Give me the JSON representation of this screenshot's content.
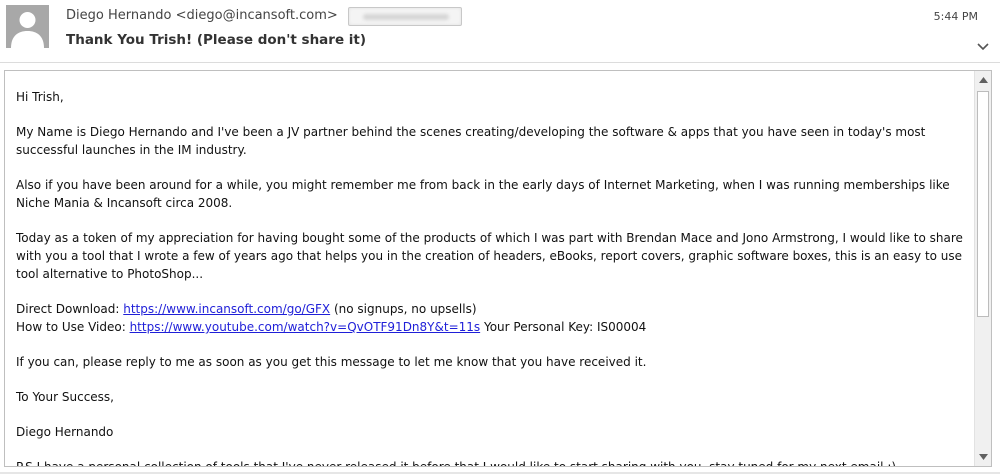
{
  "header": {
    "sender": "Diego Hernando <diego@incansoft.com>",
    "subject": "Thank You Trish! (Please don't share it)",
    "time": "5:44 PM",
    "avatar_icon": "person-silhouette-icon",
    "expand_icon": "chevron-down-icon"
  },
  "email": {
    "greeting": "Hi Trish,",
    "para1": "My Name is Diego Hernando and I've been a JV partner behind the scenes creating/developing the software & apps that you have seen in today's most successful launches in the IM industry.",
    "para2": "Also if you have been around for a while, you might remember me from back in the early days of Internet Marketing, when I was running memberships like Niche Mania & Incansoft circa 2008.",
    "para3": "Today as a token of my appreciation for having bought some of the products of which I was part with Brendan Mace and Jono Armstrong, I would like to share with you a tool that I wrote a few of years ago that helps you in the creation of headers, eBooks, report covers, graphic software boxes, this is an easy to use tool alternative to PhotoShop...",
    "download_label": "Direct Download: ",
    "download_link": "https://www.incansoft.com/go/GFX",
    "download_note": " (no signups, no upsells)",
    "video_label": "How to Use Video: ",
    "video_link": "https://www.youtube.com/watch?v=QvOTF91Dn8Y&t=11s",
    "key_text": " Your Personal Key: IS00004",
    "para4": "If you can, please reply to me as soon as you get this message to let me know that you have received it.",
    "closing": "To Your Success,",
    "signature": "Diego Hernando",
    "ps": "P.S I have a personal collection of tools that I've never released it before that I would like to start sharing with you, stay tuned for my next email :)"
  },
  "colors": {
    "link": "#1f1fd8",
    "avatar_bg": "#a8a8a8"
  }
}
